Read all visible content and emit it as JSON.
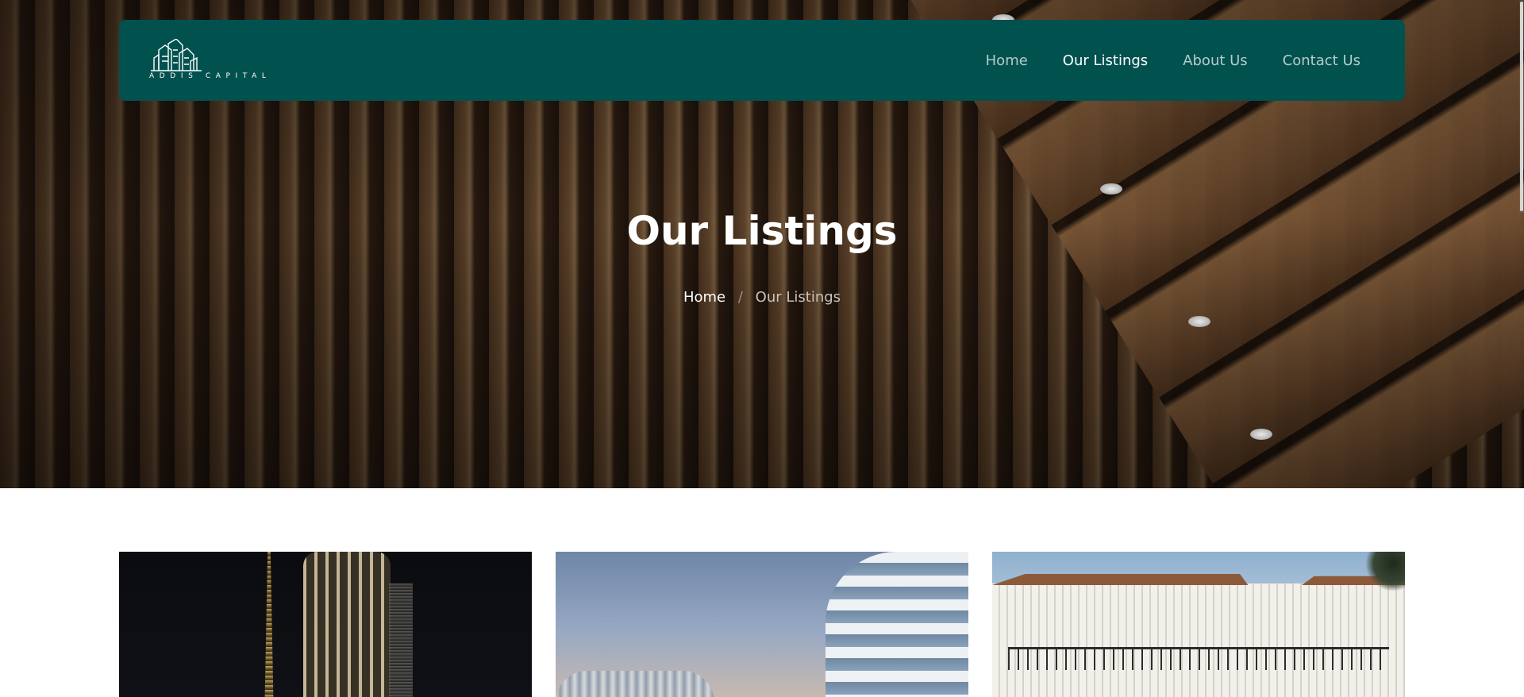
{
  "brand": {
    "name": "ADDIS CAPITAL",
    "accent_color": "#01514f"
  },
  "nav": {
    "items": [
      {
        "label": "Home",
        "active": false
      },
      {
        "label": "Our Listings",
        "active": true
      },
      {
        "label": "About Us",
        "active": false
      },
      {
        "label": "Contact Us",
        "active": false
      }
    ]
  },
  "hero": {
    "title": "Our Listings",
    "breadcrumb": {
      "home": "Home",
      "separator": "/",
      "current": "Our Listings"
    }
  },
  "listings": {
    "cards": [
      {
        "image": "night-tower-photo"
      },
      {
        "image": "curved-residential-building-photo"
      },
      {
        "image": "townhouses-photo"
      }
    ]
  }
}
